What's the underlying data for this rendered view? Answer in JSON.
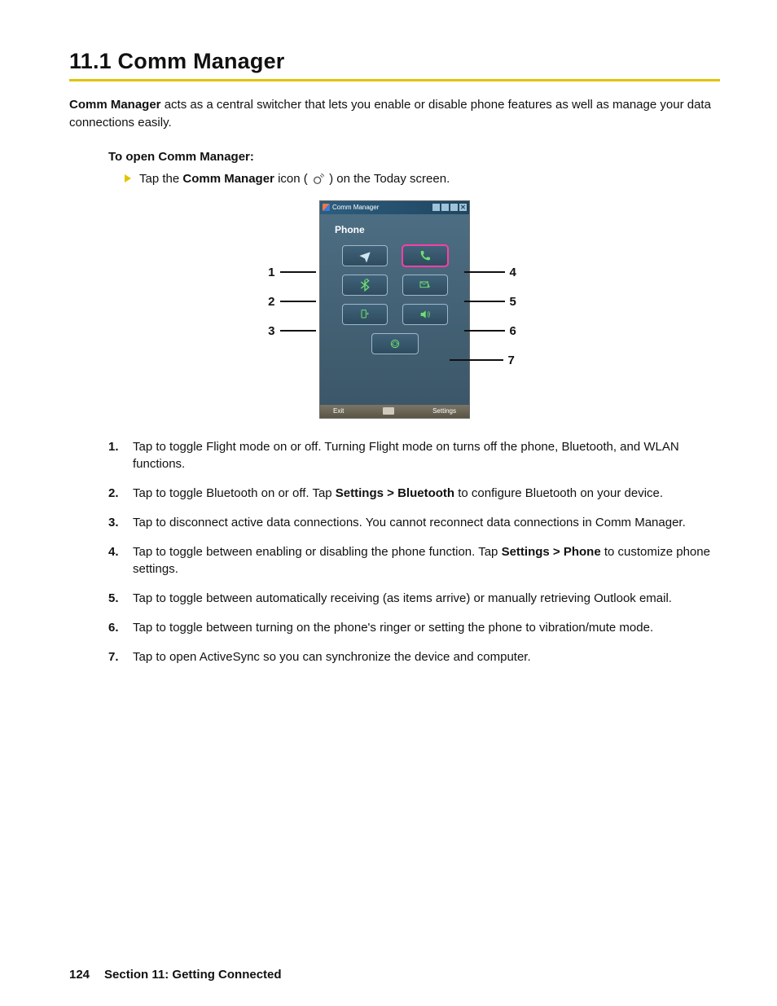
{
  "heading": "11.1  Comm Manager",
  "intro_bold": "Comm Manager",
  "intro_rest": " acts as a central switcher that lets you enable or disable phone features as well as manage your data connections easily.",
  "subhead": "To open Comm Manager:",
  "step_prefix": "Tap the ",
  "step_bold": "Comm Manager",
  "step_mid": " icon ( ",
  "step_suffix": " ) on the Today screen.",
  "device": {
    "title": "Comm Manager",
    "section_label": "Phone",
    "soft_left": "Exit",
    "soft_right": "Settings",
    "buttons": [
      {
        "name": "flight-mode",
        "callout_left": "1"
      },
      {
        "name": "phone",
        "callout_right": "4",
        "selected": true
      },
      {
        "name": "bluetooth",
        "callout_left": "2"
      },
      {
        "name": "email-receive",
        "callout_right": "5"
      },
      {
        "name": "data-connection",
        "callout_left": "3"
      },
      {
        "name": "ringer",
        "callout_right": "6"
      },
      {
        "name": "activesync",
        "callout_right": "7",
        "wide": true
      }
    ],
    "callouts": {
      "left": [
        "1",
        "2",
        "3"
      ],
      "right": [
        "4",
        "5",
        "6",
        "7"
      ]
    }
  },
  "list": [
    {
      "text_a": "Tap to toggle Flight mode on or off. Turning Flight mode on turns off the phone, Bluetooth, and WLAN functions."
    },
    {
      "text_a": "Tap to toggle Bluetooth on or off. Tap ",
      "bold": "Settings > Bluetooth",
      "text_b": " to configure Bluetooth on your device."
    },
    {
      "text_a": "Tap to disconnect active data connections. You cannot reconnect data connections in Comm Manager."
    },
    {
      "text_a": "Tap to toggle between enabling or disabling the phone function. Tap ",
      "bold": "Settings > Phone",
      "text_b": " to customize phone settings."
    },
    {
      "text_a": "Tap to toggle between automatically receiving (as items arrive) or manually retrieving Outlook email."
    },
    {
      "text_a": "Tap to toggle between turning on the phone's ringer or setting the phone to vibration/mute mode."
    },
    {
      "text_a": "Tap to open ActiveSync so you can synchronize the device and computer."
    }
  ],
  "footer": {
    "page": "124",
    "section": "Section 11: Getting Connected"
  }
}
